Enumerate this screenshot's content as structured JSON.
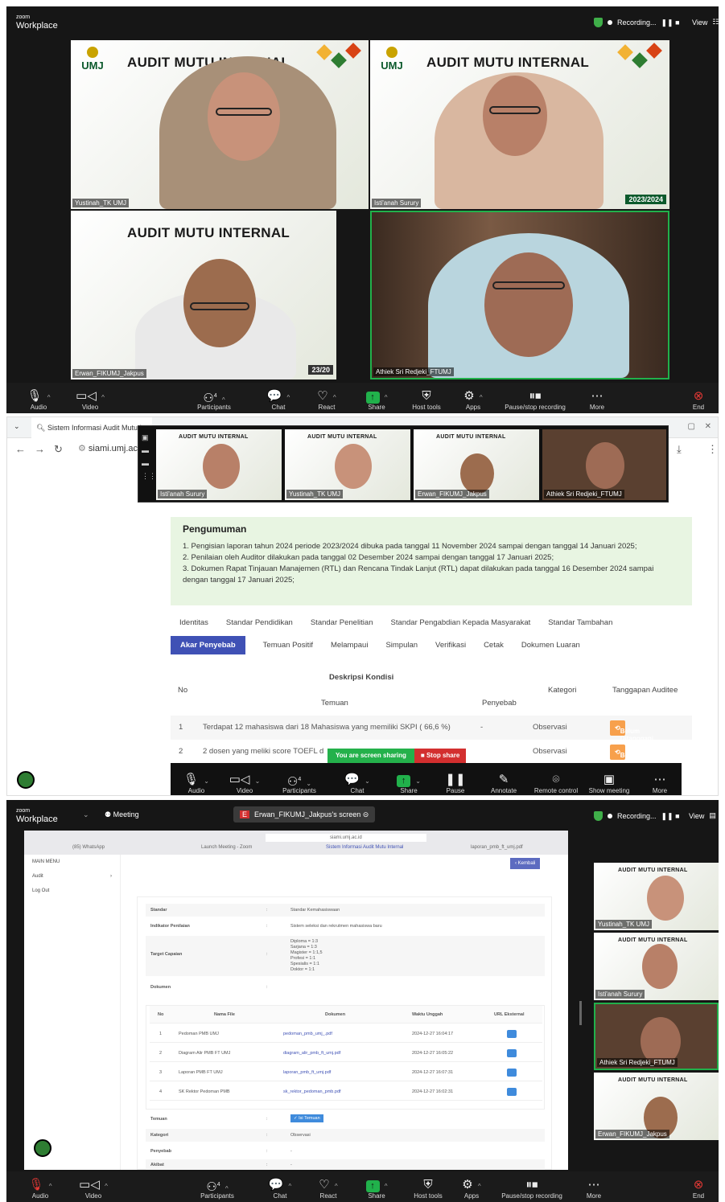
{
  "zoom": {
    "brand_small": "zoom",
    "brand": "Workplace",
    "recording": "Recording...",
    "view": "View"
  },
  "tiles": {
    "banner": "AUDIT MUTU INTERNAL",
    "logo": "UMJ",
    "year": "2023/2024",
    "year_partial": "23/20",
    "names": [
      "Yustinah_TK UMJ",
      "Isti'anah Surury",
      "Erwan_FIKUMJ_Jakpus",
      "Athiek Sri Redjeki_FTUMJ"
    ]
  },
  "toolbar": {
    "audio": "Audio",
    "video": "Video",
    "participants": "Participants",
    "participants_count": "4",
    "chat": "Chat",
    "react": "React",
    "share": "Share",
    "host_tools": "Host tools",
    "apps": "Apps",
    "pause_recording": "Pause/stop recording",
    "more": "More",
    "end": "End"
  },
  "sharing_toolbar": {
    "audio": "Audio",
    "video": "Video",
    "participants": "Participants",
    "participants_count": "4",
    "chat": "Chat",
    "share": "Share",
    "pause": "Pause",
    "annotate": "Annotate",
    "remote_control": "Remote control",
    "show_meeting": "Show meeting",
    "more": "More"
  },
  "browser": {
    "tab_title": "Sistem Informasi Audit Mutu I",
    "address": "siami.umj.ac",
    "announcement_title": "Pengumuman",
    "announcements": [
      "1. Pengisian laporan tahun 2024 periode 2023/2024 dibuka pada tanggal 11 November 2024 sampai dengan tanggal 14 Januari 2025;",
      "2. Penilaian oleh Auditor dilakukan pada tanggal 02 Desember 2024 sampai dengan tanggal 17 Januari 2025;",
      "3. Dokumen Rapat Tinjauan Manajemen (RTL) dan Rencana Tindak Lanjut (RTL) dapat dilakukan pada tanggal 16 Desember 2024 sampai dengan tanggal 17 Januari 2025;"
    ],
    "tabs_row1": [
      "Identitas",
      "Standar Pendidikan",
      "Standar Penelitian",
      "Standar Pengabdian Kepada Masyarakat",
      "Standar Tambahan"
    ],
    "tabs_row2": [
      "Akar Penyebab",
      "Temuan Positif",
      "Melampaui",
      "Simpulan",
      "Verifikasi",
      "Cetak",
      "Dokumen Luaran"
    ],
    "table_headers": {
      "no": "No",
      "deskripsi": "Deskripsi Kondisi",
      "temuan": "Temuan",
      "penyebab": "Penyebab",
      "kategori": "Kategori",
      "tanggapan": "Tanggapan Auditee"
    },
    "rows": [
      {
        "no": "1",
        "temuan": "Terdapat 12 mahasiswa dari 18 Mahasiswa yang memiliki SKPI ( 66,6 %)",
        "penyebab": "-",
        "kategori": "Observasi",
        "status": "Belum Ditanggapi"
      },
      {
        "no": "2",
        "temuan": "2 dosen yang meliki score TOEFL d",
        "penyebab": "",
        "kategori": "Observasi",
        "status": "Belum Ditanggapi"
      }
    ],
    "sharing": "You are screen sharing",
    "stop_share": "Stop share"
  },
  "meeting": {
    "menu": "Meeting",
    "screen_label": "Erwan_FIKUMJ_Jakpus's screen",
    "url": "siami.umj.ac.id",
    "browser_tabs": [
      "(85) WhatsApp",
      "Launch Meeting - Zoom",
      "Sistem Informasi Audit Mutu Internal",
      "laporan_pmb_ft_umj.pdf"
    ],
    "main_menu": "MAIN MENU",
    "audit": "Audit",
    "logout": "Log Out",
    "kembali": "‹ Kembali",
    "standar_label": "Standar",
    "standar_value": "Standar Kemahasiswaan",
    "indikator_label": "Indikator Penilaian",
    "indikator_value": "Sistem seleksi dan rekrutmen mahasiswa baru",
    "target_label": "Target Capaian",
    "target_values": [
      "Diploma = 1:3",
      "Sarjana = 1:3",
      "Magister = 1:1,5",
      "Profesi = 1:1",
      "Spesialis = 1:1",
      "Doktor = 1:1"
    ],
    "dokumen_label": "Dokumen",
    "doc_headers": [
      "No",
      "Nama File",
      "Dokumen",
      "Waktu Unggah",
      "URL Eksternal"
    ],
    "docs": [
      {
        "no": "1",
        "nama": "Pedoman PMB UMJ",
        "file": "pedoman_pmb_umj_.pdf",
        "waktu": "2024-12-27 16:04:17"
      },
      {
        "no": "2",
        "nama": "Diagram Alir PMB FT UMJ",
        "file": "diagram_alir_pmb_ft_umj.pdf",
        "waktu": "2024-12-27 16:05:22"
      },
      {
        "no": "3",
        "nama": "Laporan PMB FT UMJ",
        "file": "laporan_pmb_ft_umj.pdf",
        "waktu": "2024-12-27 16:07:31"
      },
      {
        "no": "4",
        "nama": "SK Rektor Pedoman PMB",
        "file": "sk_rektor_pedoman_pmb.pdf",
        "waktu": "2024-12-27 16:02:31"
      }
    ],
    "temuan_label": "Temuan",
    "temuan_btn": "✓ Isi Temuan",
    "kategori_label": "Kategori",
    "kategori_value": "Observasi",
    "penyebab_label": "Penyebab",
    "penyebab_value": "-",
    "akibat_label": "Akibat",
    "akibat_value": "-"
  },
  "colors": {
    "zoom_green": "#21b14b",
    "active_tab": "#3f51b5",
    "badge": "#f7a04c",
    "announce_bg": "#e8f5e2"
  }
}
